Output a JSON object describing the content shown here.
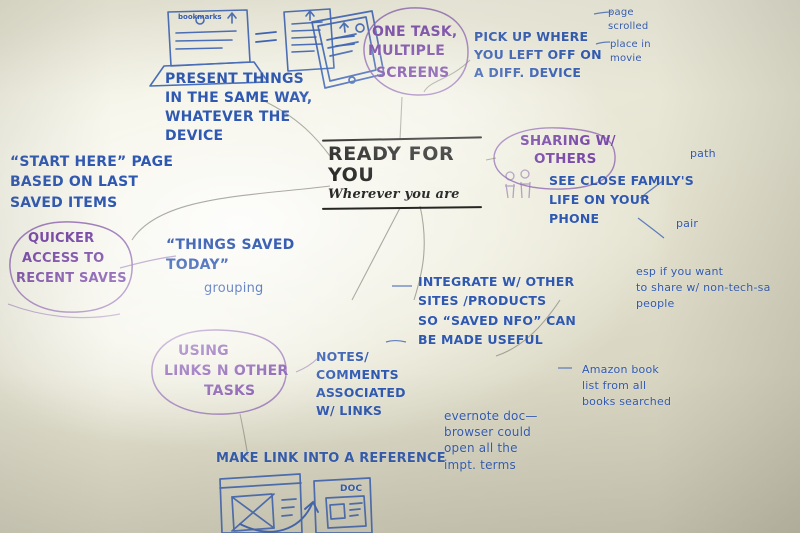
{
  "board": {
    "surface": "whiteboard-photo",
    "ink_colors": {
      "blue": "#2f58b0",
      "purple": "#7a4aa8",
      "black": "#2a2a28"
    }
  },
  "center": {
    "title": "READY FOR YOU",
    "subtitle": "Wherever you are"
  },
  "bubbles": [
    {
      "id": "one-task",
      "line1": "ONE TASK,",
      "line2": "MULTIPLE",
      "line3": "SCREENS"
    },
    {
      "id": "sharing",
      "line1": "SHARING W/",
      "line2": "OTHERS"
    },
    {
      "id": "quicker",
      "line1": "QUICKER",
      "line2": "ACCESS TO",
      "line3": "RECENT SAVES"
    },
    {
      "id": "using-links",
      "line1": "USING",
      "line2": "LINKS n OTHER",
      "line3": "TASKS"
    }
  ],
  "notes": {
    "bookmarks_label": "bookmarks",
    "doc_label": "Doc",
    "present_things": "PRESENT THINGS\nIN THE SAME WAY,\nWHATEVER THE\nDEVICE",
    "pick_up_where": "PICK UP WHERE\n  YOU LEFT OFF ON\nA DIFF. DEVICE",
    "page_scrolled": "page\n   scrolled",
    "place_in_movie": "place in\nmovie",
    "start_here": "“START HERE” PAGE\nBASED on last\nSAVED ITEMS",
    "things_saved_today": "“THINGS SAVED\n    TODAY”",
    "grouping": "grouping",
    "see_close_family": "SEE CLOSE FAMILY'S\nLIFE ON YOUR\nPHONE",
    "path": "path",
    "pair": "pair",
    "esp_if": "esp if  you want\n  to share w/ non-tech-sa\npeople",
    "integrate": "INTEGRATE W/ OTHER\n SITES /PRODUCTS\nSO “SAVED NFO” CAN\nBE MADE USEFUL",
    "notes_comments": "NOTES/\nCOMMENTS\nASSOCIATED\nW/ LINKS",
    "amazon_book": "Amazon book\nlist from all\nbooks searched",
    "evernote_doc": "evernote doc—\nbrowser could\nopen all the\nimpt. terms",
    "make_link": "MAKE LINK INTO A REFERENCE"
  }
}
